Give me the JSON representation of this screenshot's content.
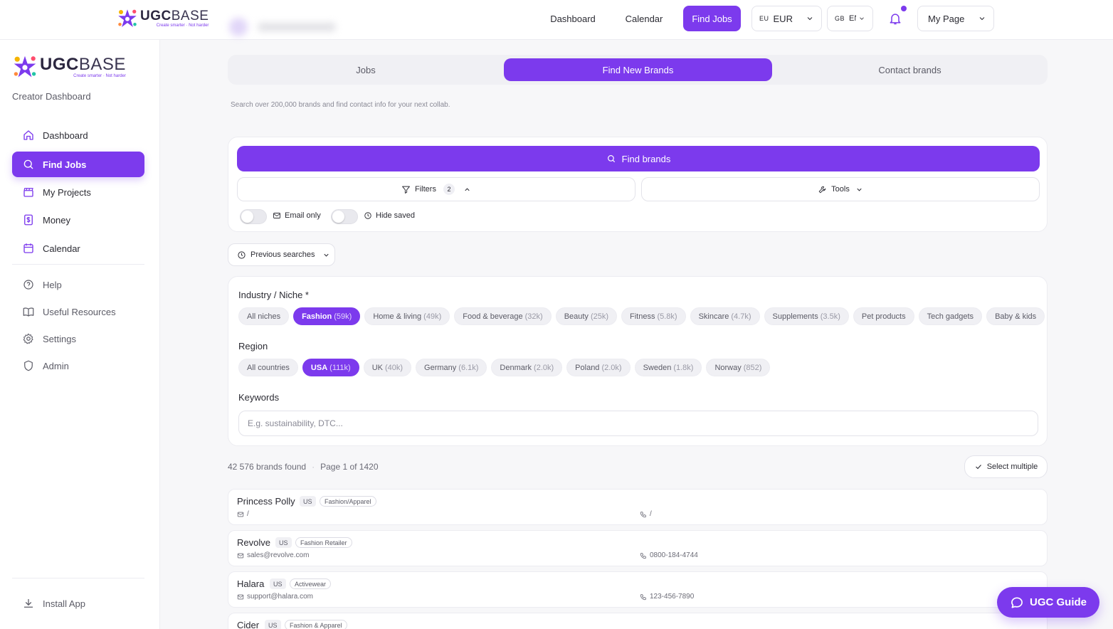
{
  "logo": {
    "brand_bold": "UGC",
    "brand_light": "BASE",
    "tagline": "Create smarter · Not harder"
  },
  "topnav": {
    "items": [
      {
        "label": "Dashboard",
        "active": false
      },
      {
        "label": "Calendar",
        "active": false
      },
      {
        "label": "Find Jobs",
        "active": true
      }
    ],
    "currency": {
      "prefix": "EU",
      "value": "EUR"
    },
    "language": {
      "prefix": "GB",
      "value": "EN"
    },
    "my_page": "My Page",
    "accent_color": "#7c3aed"
  },
  "sidebar": {
    "subtitle": "Creator Dashboard",
    "items": [
      {
        "label": "Dashboard",
        "icon": "home-icon",
        "active": false
      },
      {
        "label": "Find Jobs",
        "icon": "search-icon",
        "active": true
      },
      {
        "label": "My Projects",
        "icon": "clapperboard-icon",
        "active": false
      },
      {
        "label": "Money",
        "icon": "dollar-icon",
        "active": false
      },
      {
        "label": "Calendar",
        "icon": "calendar-icon",
        "active": false
      }
    ],
    "secondary": [
      {
        "label": "Help",
        "icon": "help-icon"
      },
      {
        "label": "Useful Resources",
        "icon": "book-icon"
      },
      {
        "label": "Settings",
        "icon": "gear-icon"
      },
      {
        "label": "Admin",
        "icon": "shield-icon"
      }
    ],
    "install": "Install App"
  },
  "tabs": [
    {
      "label": "Jobs",
      "active": false
    },
    {
      "label": "Find New Brands",
      "active": true
    },
    {
      "label": "Contact brands",
      "active": false
    }
  ],
  "subtitle": "Search over 200,000 brands and find contact info for your next collab.",
  "search": {
    "find_label": "Find brands",
    "filters_label": "Filters",
    "filters_count": "2",
    "tools_label": "Tools",
    "email_only": "Email only",
    "hide_saved": "Hide saved"
  },
  "previous_searches": "Previous searches",
  "filters": {
    "industry_label": "Industry / Niche *",
    "industries": [
      {
        "label": "All niches",
        "count": "",
        "active": false
      },
      {
        "label": "Fashion",
        "count": "(59k)",
        "active": true
      },
      {
        "label": "Home & living",
        "count": "(49k)",
        "active": false
      },
      {
        "label": "Food & beverage",
        "count": "(32k)",
        "active": false
      },
      {
        "label": "Beauty",
        "count": "(25k)",
        "active": false
      },
      {
        "label": "Fitness",
        "count": "(5.8k)",
        "active": false
      },
      {
        "label": "Skincare",
        "count": "(4.7k)",
        "active": false
      },
      {
        "label": "Supplements",
        "count": "(3.5k)",
        "active": false
      },
      {
        "label": "Pet products",
        "count": "",
        "active": false
      },
      {
        "label": "Tech gadgets",
        "count": "",
        "active": false
      },
      {
        "label": "Baby & kids",
        "count": "",
        "active": false
      }
    ],
    "region_label": "Region",
    "regions": [
      {
        "label": "All countries",
        "count": "",
        "active": false
      },
      {
        "label": "USA",
        "count": "(111k)",
        "active": true
      },
      {
        "label": "UK",
        "count": "(40k)",
        "active": false
      },
      {
        "label": "Germany",
        "count": "(6.1k)",
        "active": false
      },
      {
        "label": "Denmark",
        "count": "(2.0k)",
        "active": false
      },
      {
        "label": "Poland",
        "count": "(2.0k)",
        "active": false
      },
      {
        "label": "Sweden",
        "count": "(1.8k)",
        "active": false
      },
      {
        "label": "Norway",
        "count": "(852)",
        "active": false
      }
    ],
    "keywords_label": "Keywords",
    "keywords_placeholder": "E.g. sustainability, DTC...",
    "keywords_value": ""
  },
  "results": {
    "count": "42 576 brands found",
    "page": "Page 1 of 1420",
    "select_multiple": "Select multiple",
    "brands": [
      {
        "name": "Princess Polly",
        "country": "US",
        "category": "Fashion/Apparel",
        "email": "/",
        "phone": "/"
      },
      {
        "name": "Revolve",
        "country": "US",
        "category": "Fashion Retailer",
        "email": "sales@revolve.com",
        "phone": "0800-184-4744"
      },
      {
        "name": "Halara",
        "country": "US",
        "category": "Activewear",
        "email": "support@halara.com",
        "phone": "123-456-7890"
      },
      {
        "name": "Cider",
        "country": "US",
        "category": "Fashion & Apparel",
        "email": "",
        "phone": ""
      }
    ]
  },
  "guide_button": "UGC Guide"
}
